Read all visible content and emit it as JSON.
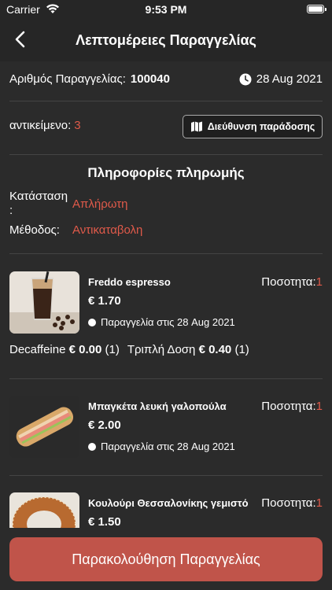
{
  "status_bar": {
    "carrier": "Carrier",
    "time": "9:53 PM"
  },
  "nav": {
    "title": "Λεπτομέρειες Παραγγελίας"
  },
  "order": {
    "number_label": "Αριθμός Παραγγελίας:",
    "number": "100040",
    "date": "28 Aug 2021",
    "items_label": "αντικείμενο:",
    "items_count": "3",
    "address_button": "Διεύθυνση παράδοσης"
  },
  "payment": {
    "title": "Πληροφορίες πληρωμής",
    "status_label": "Κατάσταση :",
    "status_value": "Απλήρωτη",
    "method_label": "Μέθοδος:",
    "method_value": "Αντικαταβολη"
  },
  "products": [
    {
      "name": "Freddo espresso",
      "qty_label": "Ποσοτητα:",
      "qty": "1",
      "price": "€ 1.70",
      "ordered": "Παραγγελία στις 28 Aug 2021"
    },
    {
      "name": "Μπαγκέτα λευκή γαλοπούλα",
      "qty_label": "Ποσοτητα:",
      "qty": "1",
      "price": "€ 2.00",
      "ordered": "Παραγγελία στις 28 Aug 2021"
    },
    {
      "name": "Κουλούρι Θεσσαλονίκης γεμιστό",
      "qty_label": "Ποσοτητα:",
      "qty": "1",
      "price": "€ 1.50"
    }
  ],
  "extras": [
    {
      "name": "Decaffeine",
      "price": "€ 0.00",
      "qty": "(1)"
    },
    {
      "name": "Τριπλή Δοση",
      "price": "€ 0.40",
      "qty": "(1)"
    }
  ],
  "track_button": "Παρακολούθηση Παραγγελίας",
  "colors": {
    "accent": "#e05a4a",
    "button": "#c0544a",
    "background": "#2b2b2b",
    "bar": "#262626"
  }
}
